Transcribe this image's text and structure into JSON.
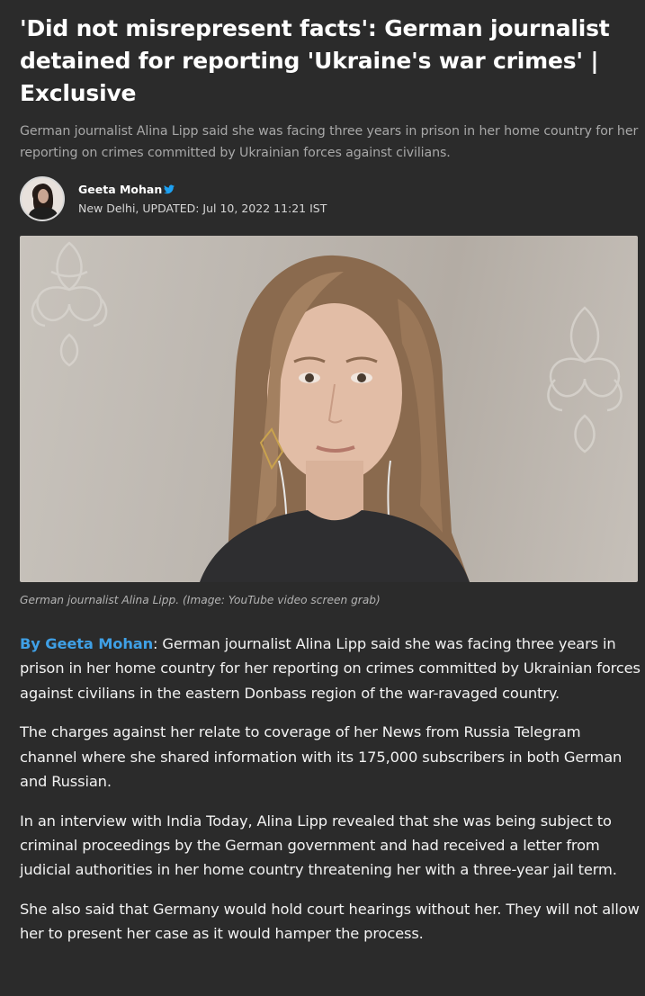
{
  "article": {
    "headline": "'Did not misrepresent facts': German journalist detained for reporting 'Ukraine's war crimes' | Exclusive",
    "summary": "German journalist Alina Lipp said she was facing three years in prison in her home country for her reporting on crimes committed by Ukrainian forces against civilians.",
    "author": {
      "name": "Geeta Mohan",
      "verified_icon": "twitter-bird-icon",
      "location": "New Delhi,",
      "updated": "UPDATED: Jul 10, 2022 11:21 IST"
    },
    "image_caption": "German journalist Alina Lipp. (Image: YouTube video screen grab)",
    "body": {
      "p1_link": "By Geeta Mohan",
      "p1_text": ": German journalist Alina Lipp said she was facing three years in prison in her home country for her reporting on crimes committed by Ukrainian forces against civilians in the eastern Donbass region of the war-ravaged country.",
      "p2": "The charges against her relate to coverage of her News from Russia Telegram channel where she shared information with its 175,000 subscribers in both German and Russian.",
      "p3": "In an interview with India Today, Alina Lipp revealed that she was being subject to criminal proceedings by the German government and had received a letter from judicial authorities in her home country threatening her with a three-year jail term.",
      "p4": "She also said that Germany would hold court hearings without her. They will not allow her to present her case as it would hamper the process."
    }
  },
  "colors": {
    "background": "#2b2b2b",
    "link": "#3fa0e6",
    "twitter": "#1da1f2"
  }
}
